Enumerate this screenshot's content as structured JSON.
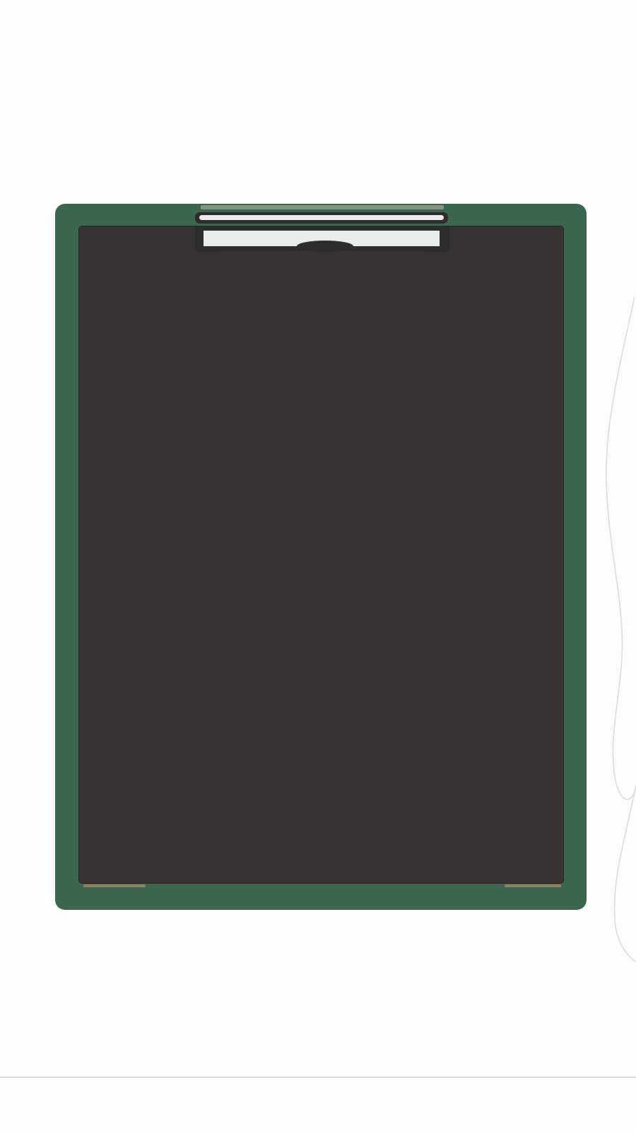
{
  "colors": {
    "background": "#fdfdfd",
    "board_frame": "#3b6650",
    "board_face": "#383232",
    "clip_metal": "#e9ecec",
    "clip_shadow": "#2d2d2d",
    "clip_band": "#8a9381",
    "felt_accent": "#8e8260",
    "floor_line": "#bdbdbd",
    "paper_edge": "#dcdcdc"
  },
  "icons": {
    "board": "clipboard-icon",
    "clip": "metal-clip-icon"
  }
}
